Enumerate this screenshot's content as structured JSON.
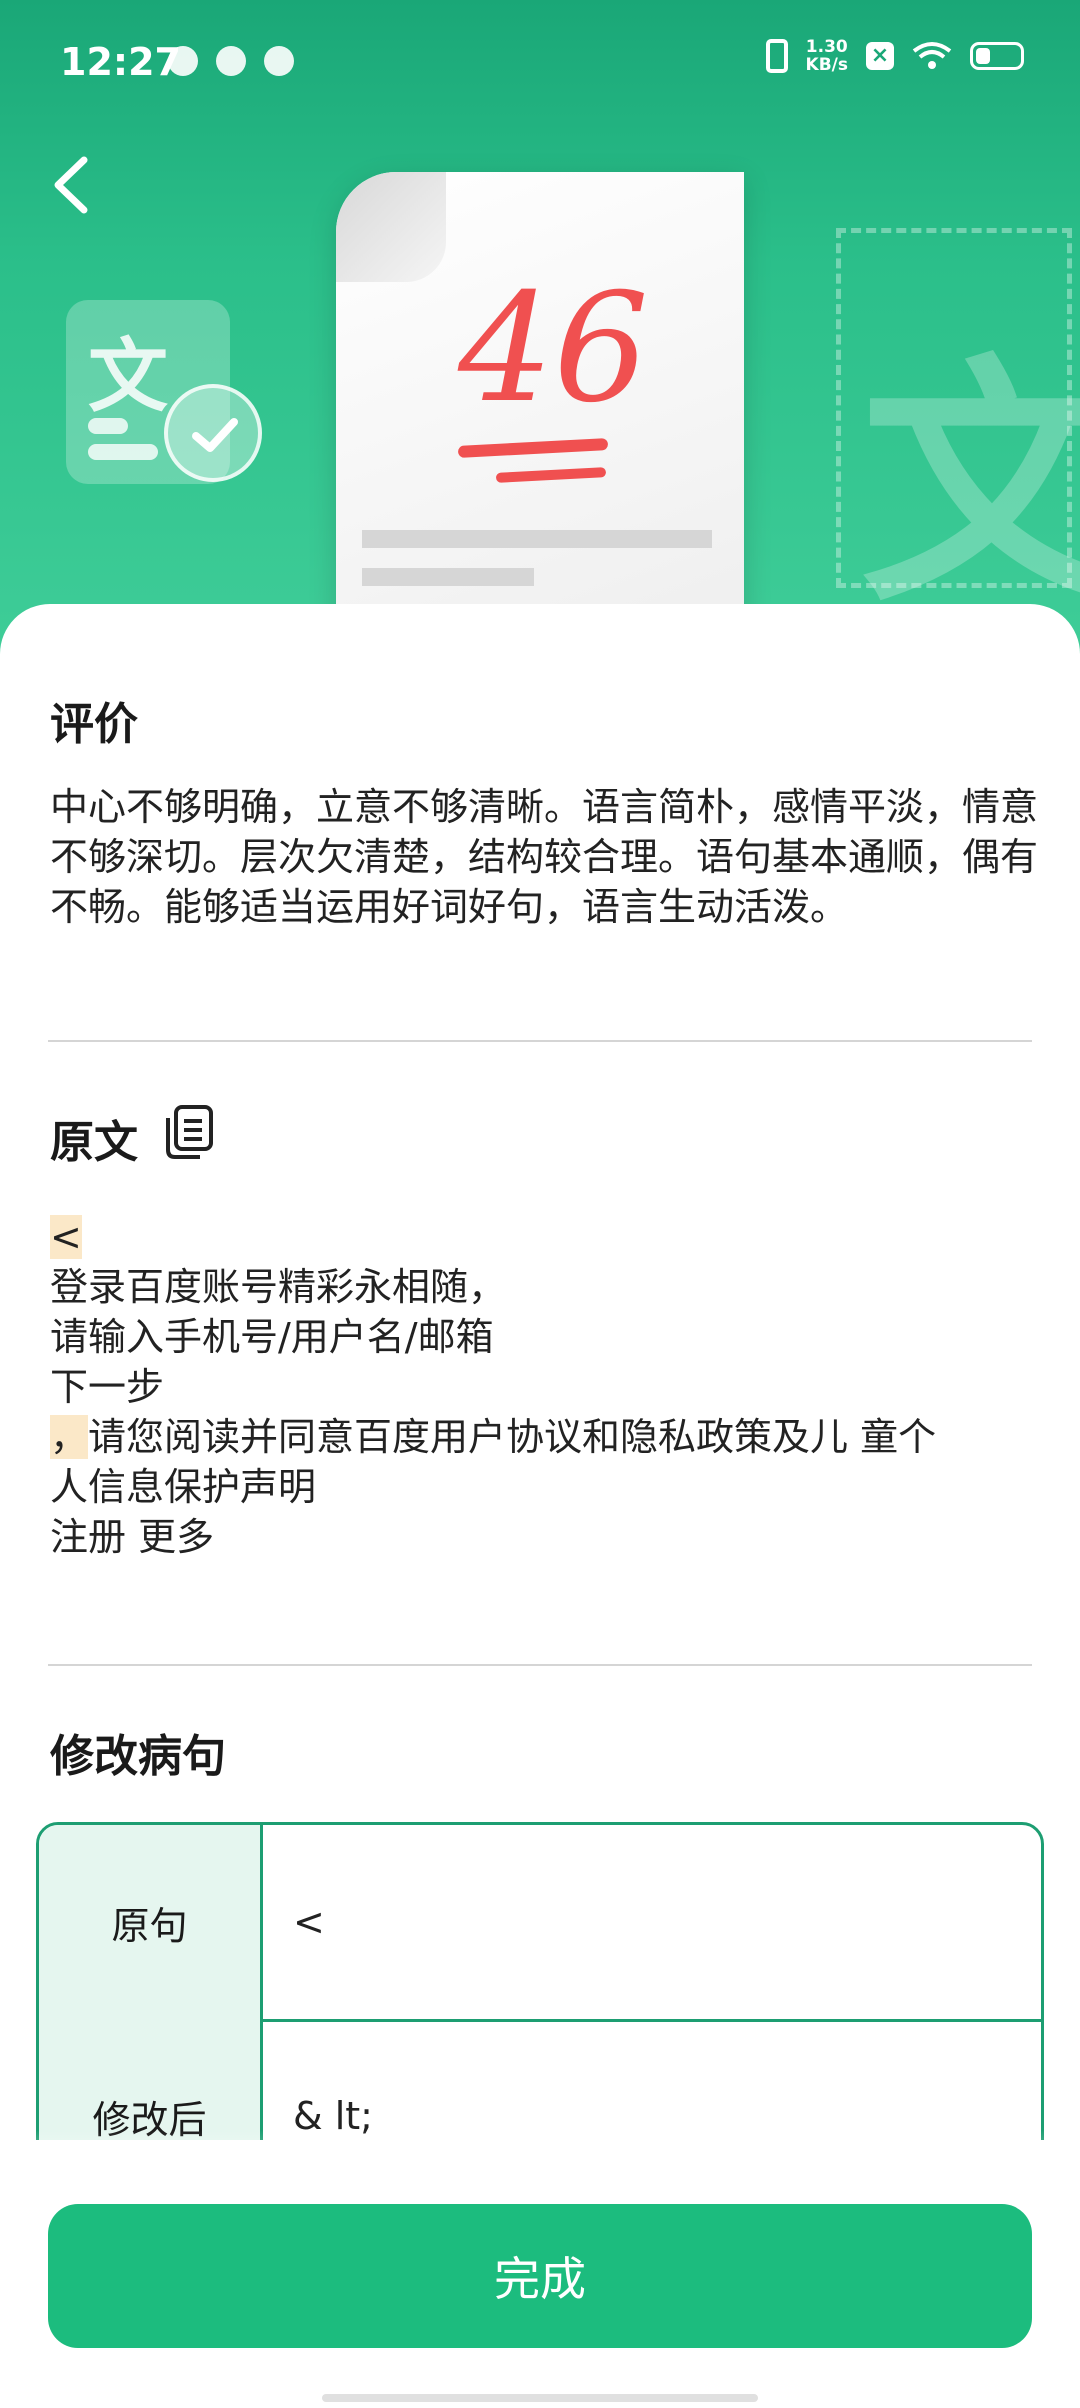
{
  "status_bar": {
    "time": "12:27",
    "speed_top": "1.30",
    "speed_bottom": "KB/s"
  },
  "header": {
    "back_icon": "chevron-left-icon",
    "score": "46",
    "decor_char": "文"
  },
  "evaluation": {
    "title": "评价",
    "text": "中心不够明确，立意不够清晰。语言简朴，感情平淡，情意不够深切。层次欠清楚，结构较合理。语句基本通顺，偶有不畅。能够适当运用好词好句，语言生动活泼。"
  },
  "original": {
    "title": "原文",
    "copy_icon": "copy-icon",
    "line1": "<",
    "line2": "登录百度账号精彩永相随，",
    "line3": "请输入手机号/用户名/邮箱",
    "line4": "下一步",
    "line5_mark": "，",
    "line5": "请您阅读并同意百度用户协议和隐私政策及儿 童个",
    "line6": "人信息保护声明",
    "line7": "注册 更多"
  },
  "corrections": {
    "title": "修改病句",
    "rows": [
      {
        "label": "原句",
        "value": "<"
      },
      {
        "label": "修改后",
        "value": "& lt;"
      }
    ]
  },
  "footer": {
    "done_label": "完成"
  },
  "colors": {
    "accent": "#1cbc7e",
    "header_green": "#2bbf8a",
    "score_red": "#f05050"
  }
}
